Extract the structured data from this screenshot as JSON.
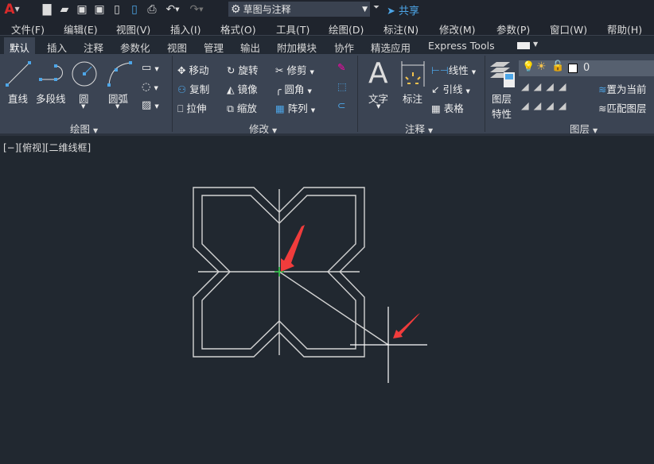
{
  "quick_access": {
    "workspace": "草图与注释",
    "share": "共享",
    "icons": [
      "app-logo-icon",
      "new-icon",
      "open-icon",
      "save-icon",
      "save-as-icon",
      "open-from-cloud-icon",
      "save-to-cloud-icon",
      "print-icon",
      "undo-icon",
      "redo-icon",
      "gear-icon"
    ]
  },
  "menu": [
    "文件(F)",
    "编辑(E)",
    "视图(V)",
    "插入(I)",
    "格式(O)",
    "工具(T)",
    "绘图(D)",
    "标注(N)",
    "修改(M)",
    "参数(P)",
    "窗口(W)",
    "帮助(H)"
  ],
  "tabs": [
    "默认",
    "插入",
    "注释",
    "参数化",
    "视图",
    "管理",
    "输出",
    "附加模块",
    "协作",
    "精选应用",
    "Express Tools"
  ],
  "panels": {
    "draw": {
      "title": "绘图",
      "line": "直线",
      "polyline": "多段线",
      "circle": "圆",
      "arc": "圆弧"
    },
    "modify": {
      "title": "修改",
      "move": "移动",
      "rotate": "旋转",
      "trim": "修剪",
      "copy": "复制",
      "mirror": "镜像",
      "fillet": "圆角",
      "stretch": "拉伸",
      "scale": "缩放",
      "array": "阵列"
    },
    "annotation": {
      "title": "注释",
      "text": "文字",
      "dimension": "标注",
      "linear": "线性",
      "leader": "引线",
      "table": "表格"
    },
    "layers": {
      "title": "图层",
      "properties_line1": "图层",
      "properties_line2": "特性",
      "current_layer": "0",
      "set_current": "置为当前",
      "match": "匹配图层"
    }
  },
  "viewport": {
    "label": "[−][俯视][二维线框]"
  },
  "colors": {
    "accent": "#4da6e8",
    "arrow": "#f03c3c",
    "canvas": "#212830"
  }
}
